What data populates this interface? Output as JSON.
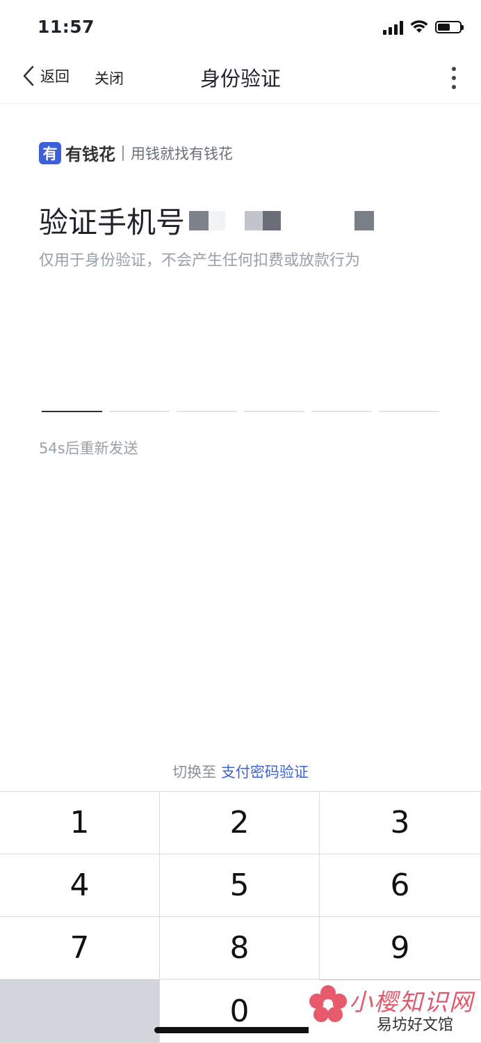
{
  "status_bar": {
    "time": "11:57",
    "battery_level": 0.55
  },
  "nav": {
    "back_label": "返回",
    "close_label": "关闭",
    "title": "身份验证"
  },
  "brand": {
    "logo_text": "有",
    "name": "有钱花",
    "slogan": "用钱就找有钱花",
    "accent_color": "#3d5fd8"
  },
  "verify": {
    "title": "验证手机号",
    "subtitle": "仅用于身份验证，不会产生任何扣费或放款行为",
    "code_length": 6,
    "filled_digits": 0,
    "resend_text": "54s后重新发送"
  },
  "switch": {
    "prefix": "切换至",
    "link_label": "支付密码验证",
    "link_color": "#3d63d6"
  },
  "keypad": {
    "keys": [
      "1",
      "2",
      "3",
      "4",
      "5",
      "6",
      "7",
      "8",
      "9",
      "",
      "0",
      ""
    ]
  },
  "watermark": {
    "title": "小樱知识网",
    "subtitle": "易坊好文馆"
  }
}
